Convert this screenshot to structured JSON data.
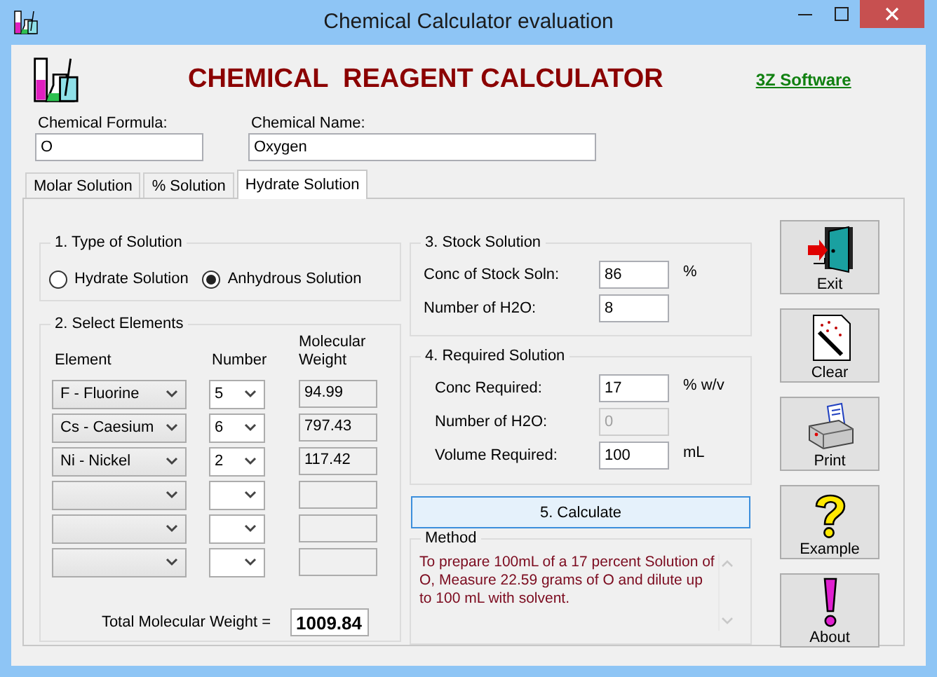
{
  "window": {
    "title": "Chemical Calculator evaluation"
  },
  "header": {
    "title": "CHEMICAL  REAGENT CALCULATOR",
    "link": "3Z Software"
  },
  "fields": [
    {
      "label": "Chemical Formula:",
      "value": "O"
    },
    {
      "label": "Chemical Name:",
      "value": "Oxygen"
    }
  ],
  "tabs": [
    {
      "label": "Molar Solution",
      "selected": false
    },
    {
      "label": "% Solution",
      "selected": false
    },
    {
      "label": "Hydrate Solution",
      "selected": true
    }
  ],
  "type_of_solution": {
    "title": "1. Type of Solution",
    "options": [
      {
        "label": "Hydrate Solution",
        "selected": false
      },
      {
        "label": "Anhydrous Solution",
        "selected": true
      }
    ]
  },
  "select_elements": {
    "title": "2. Select Elements",
    "columns": [
      "Element",
      "Number",
      "Molecular Weight"
    ],
    "rows": [
      {
        "element": "F  - Fluorine",
        "number": "5",
        "weight": "94.99"
      },
      {
        "element": "Cs - Caesium",
        "number": "6",
        "weight": "797.43"
      },
      {
        "element": "Ni - Nickel",
        "number": "2",
        "weight": "117.42"
      },
      {},
      {},
      {}
    ],
    "total_label": "Total Molecular Weight =",
    "total_value": "1009.84"
  },
  "stock_solution": {
    "title": "3. Stock Solution",
    "rows": [
      {
        "label": "Conc of Stock Soln:",
        "value": "86",
        "unit": "%"
      },
      {
        "label": "Number of H2O:",
        "value": "8"
      }
    ]
  },
  "required_solution": {
    "title": "4. Required Solution",
    "rows": [
      {
        "label": "Conc Required:",
        "value": "17",
        "unit": "% w/v",
        "disabled": false
      },
      {
        "label": "Number of H2O:",
        "value": "0",
        "disabled": true
      },
      {
        "label": "Volume Required:",
        "value": "100",
        "unit": "mL",
        "disabled": false
      }
    ]
  },
  "calculate_button": "5. Calculate",
  "method": {
    "title": "Method",
    "text": "To prepare 100mL of a 17 percent Solution of O, Measure 22.59 grams of O and dilute up to 100 mL with solvent."
  },
  "side_buttons": [
    {
      "label": "Exit",
      "kind": "exit"
    },
    {
      "label": "Clear",
      "kind": "clear"
    },
    {
      "label": "Print",
      "kind": "print"
    },
    {
      "label": "Example",
      "kind": "example"
    },
    {
      "label": "About",
      "kind": "about"
    }
  ]
}
